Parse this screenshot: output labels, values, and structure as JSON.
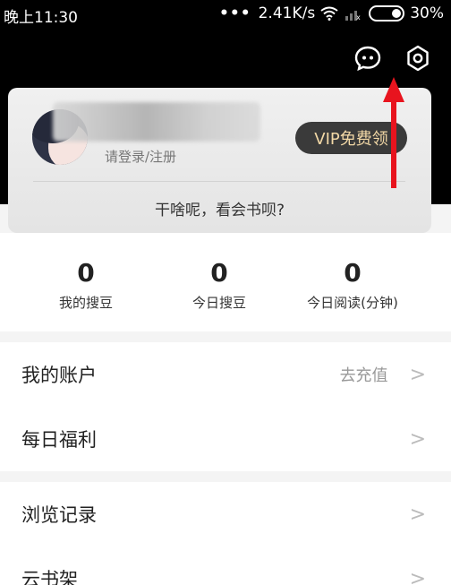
{
  "status_bar": {
    "time": "晚上11:30",
    "network_speed": "2.41K/s",
    "battery": "30%"
  },
  "header": {
    "message_icon": "message-icon",
    "settings_icon": "gear-icon"
  },
  "profile": {
    "login_text": "请登录/注册",
    "vip_label": "VIP免费领",
    "slogan": "干啥呢，看会书呗?"
  },
  "stats": [
    {
      "value": "0",
      "label": "我的搜豆"
    },
    {
      "value": "0",
      "label": "今日搜豆"
    },
    {
      "value": "0",
      "label": "今日阅读(分钟)"
    }
  ],
  "menu_group_1": [
    {
      "label": "我的账户",
      "hint": "去充值"
    },
    {
      "label": "每日福利",
      "hint": ""
    }
  ],
  "menu_group_2": [
    {
      "label": "浏览记录",
      "hint": ""
    },
    {
      "label": "云书架",
      "hint": ""
    }
  ],
  "colors": {
    "annotation_arrow": "#e8141e",
    "vip_text": "#f2d8a6"
  }
}
